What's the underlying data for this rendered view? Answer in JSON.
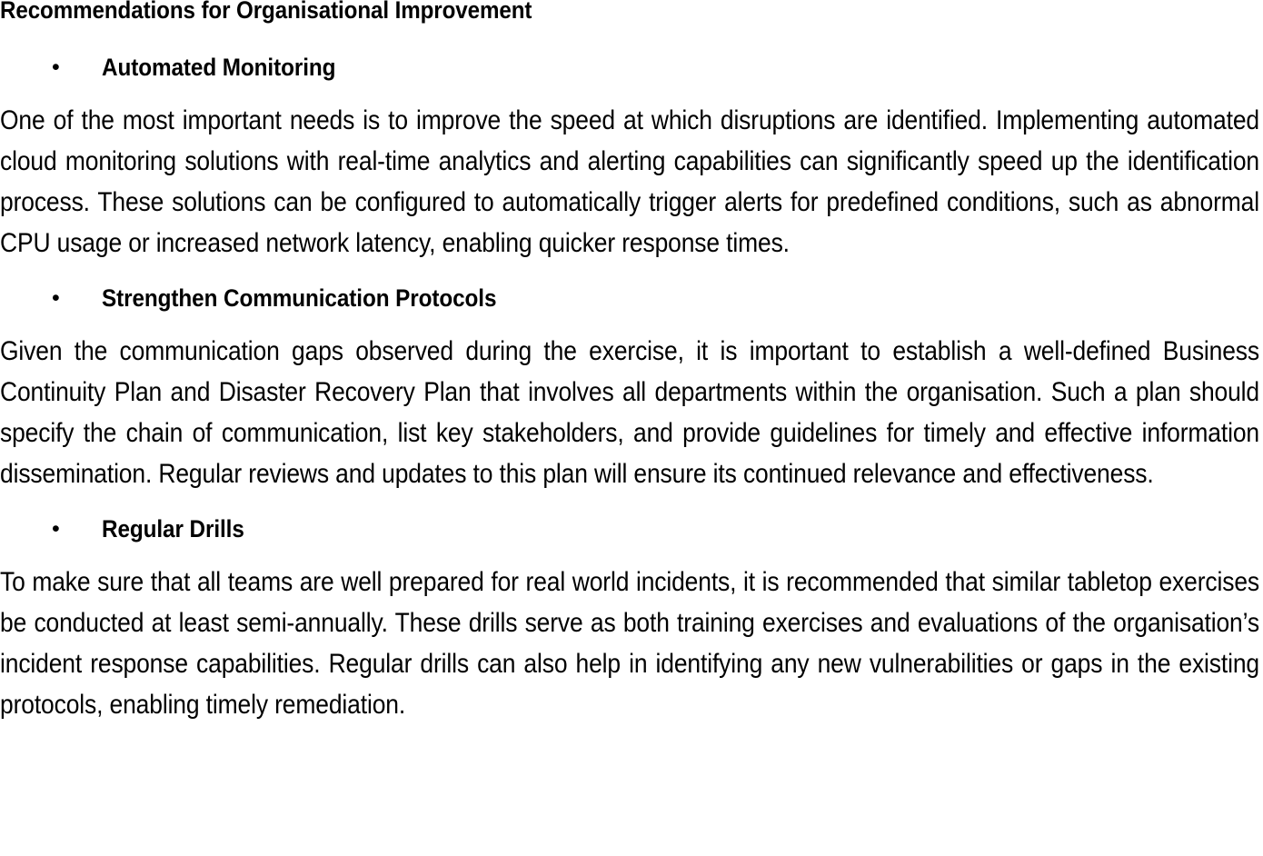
{
  "document": {
    "heading": "Recommendations for Organisational Improvement",
    "bullet_glyph": "•",
    "sections": [
      {
        "bullet_label": "Automated Monitoring",
        "paragraph": "One of the most important needs is to improve the speed at which disruptions are identified. Implementing automated cloud monitoring solutions with real-time analytics and alerting capabilities can significantly speed up the identification process. These solutions can be configured to automatically trigger alerts for predefined conditions, such as abnormal CPU usage or increased network latency, enabling quicker response times."
      },
      {
        "bullet_label": "Strengthen Communication Protocols",
        "paragraph": "Given the communication gaps observed during the exercise, it is important to establish a well-defined Business Continuity Plan and Disaster Recovery Plan that involves all departments within the organisation. Such a plan should specify the chain of communication, list key stakeholders, and provide guidelines for timely and effective information dissemination. Regular reviews and updates to this plan will ensure its continued relevance and effectiveness."
      },
      {
        "bullet_label": "Regular Drills",
        "paragraph": "To make sure that all teams are well prepared for real world incidents, it is recommended that similar tabletop exercises be conducted at least semi-annually. These drills serve as both training exercises and evaluations of the organisation’s incident response capabilities. Regular drills can also help in identifying any new vulnerabilities or gaps in the existing protocols, enabling timely remediation."
      }
    ],
    "colors": {
      "text": "#000000",
      "background": "#ffffff"
    }
  }
}
